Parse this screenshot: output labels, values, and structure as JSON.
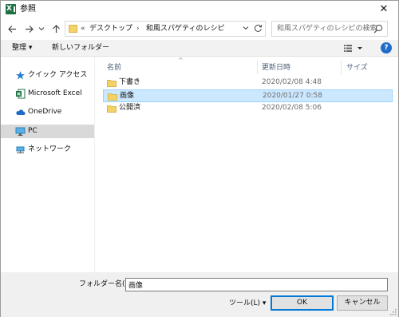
{
  "window": {
    "title": "参照",
    "app_icon": "excel-icon",
    "close_label": "✕"
  },
  "nav": {
    "back_icon": "arrow-left-icon",
    "forward_icon": "arrow-right-icon",
    "recent_icon": "chevron-down-icon",
    "up_icon": "arrow-up-icon",
    "breadcrumb": {
      "overflow": "«",
      "separator": "›",
      "segments": [
        "デスクトップ",
        "和風スパゲティのレシピ"
      ]
    },
    "search_placeholder": "和風スパゲティのレシピの検索"
  },
  "toolbar": {
    "organize_label": "整理 ▾",
    "new_folder_label": "新しいフォルダー",
    "help_label": "?"
  },
  "sidebar": {
    "items": [
      {
        "label": "クイック アクセス",
        "icon": "star-icon"
      },
      {
        "label": "Microsoft Excel",
        "icon": "excel-icon"
      },
      {
        "label": "OneDrive",
        "icon": "cloud-icon"
      },
      {
        "label": "PC",
        "icon": "pc-icon",
        "selected": true
      },
      {
        "label": "ネットワーク",
        "icon": "network-icon"
      }
    ]
  },
  "filelist": {
    "columns": {
      "name": "名前",
      "date": "更新日時",
      "size": "サイズ"
    },
    "rows": [
      {
        "name": "下書き",
        "date": "2020/02/08 4:48"
      },
      {
        "name": "画像",
        "date": "2020/01/27 0:58",
        "selected": true
      },
      {
        "name": "公開済",
        "date": "2020/02/08 5:06"
      }
    ]
  },
  "footer": {
    "folder_name_label": "フォルダー名(N):",
    "folder_name_value": "画像",
    "tools_label": "ツール(L) ▾",
    "ok_label": "OK",
    "cancel_label": "キャンセル"
  },
  "colors": {
    "selection": "#cce8ff",
    "folder": "#f3d267",
    "accent": "#0078d7",
    "help": "#1e6cc8",
    "excel": "#1d7044"
  }
}
